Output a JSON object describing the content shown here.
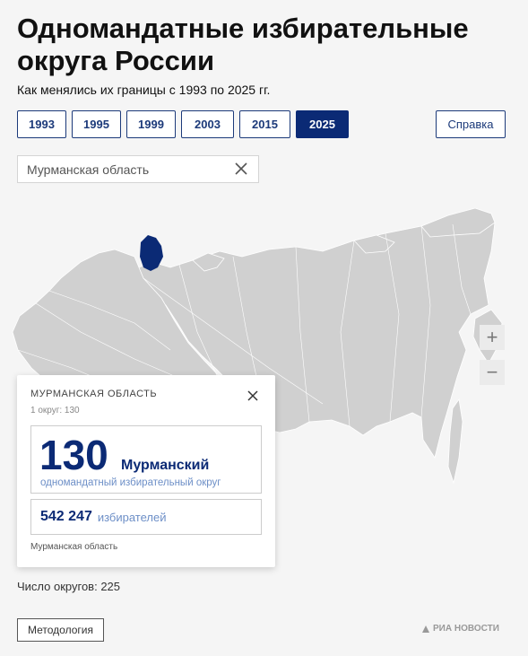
{
  "header": {
    "title": "Одномандатные избирательные округа России",
    "subtitle": "Как менялись их границы с 1993 по 2025 гг."
  },
  "years": [
    "1993",
    "1995",
    "1999",
    "2003",
    "2015",
    "2025"
  ],
  "active_year": "2025",
  "help_label": "Справка",
  "search": {
    "value": "Мурманская область"
  },
  "map": {
    "region_color": "#d0d0d0",
    "highlight_color": "#0b2a75",
    "zoom_in": "+",
    "zoom_out": "−"
  },
  "popup": {
    "title": "МУРМАНСКАЯ ОБЛАСТЬ",
    "subtitle": "1 округ: 130",
    "district_number": "130",
    "district_name": "Мурманский",
    "district_desc": "одномандатный избирательный округ",
    "voters_count": "542 247",
    "voters_label": "избирателей",
    "region": "Мурманская область"
  },
  "footer": {
    "count": "Число округов: 225",
    "methodology": "Методология",
    "logo": "РИА НОВОСТИ"
  }
}
